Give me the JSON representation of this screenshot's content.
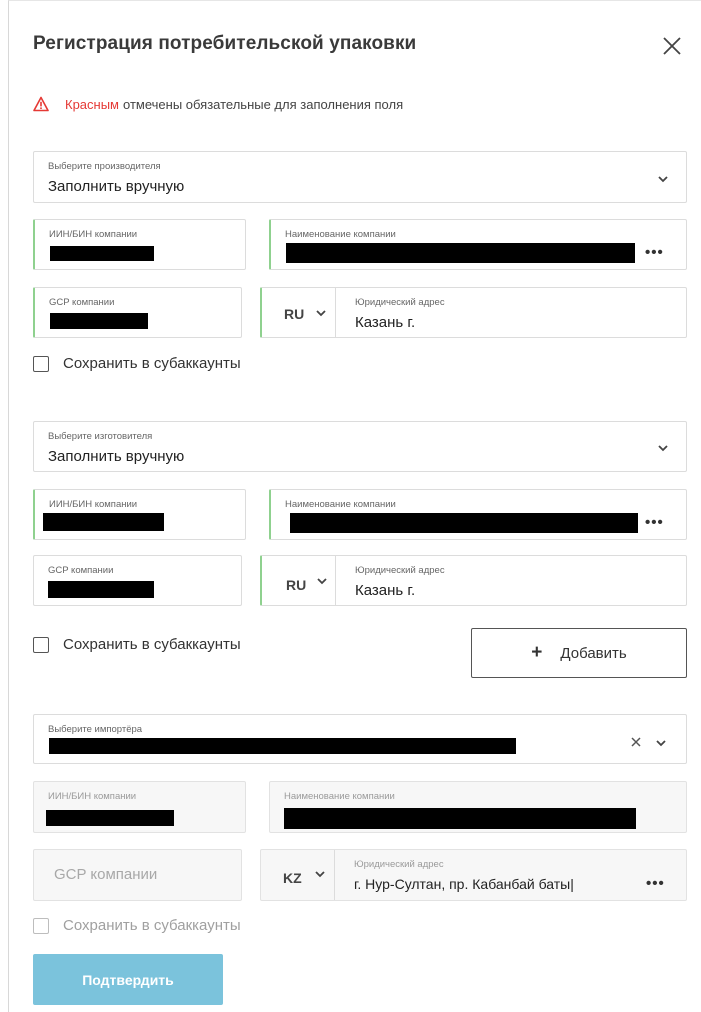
{
  "dialog": {
    "title": "Регистрация потребительской упаковки",
    "notice_red": "Красным",
    "notice_rest": "отмечены обязательные для заполнения поля",
    "colors": {
      "required": "#8fd18f",
      "confirm": "#7bc3dc",
      "warn": "#e53935"
    }
  },
  "producer": {
    "select_label": "Выберите производителя",
    "select_value": "Заполнить вручную",
    "inn_label": "ИИН/БИН компании",
    "name_label": "Наименование компании",
    "gcp_label": "GCP компании",
    "country": "RU",
    "address_label": "Юридический адрес",
    "address_value": "Казань г.",
    "save_label": "Сохранить в субаккаунты"
  },
  "manufacturer": {
    "select_label": "Выберите изготовителя",
    "select_value": "Заполнить вручную",
    "inn_label": "ИИН/БИН компании",
    "name_label": "Наименование компании",
    "gcp_label": "GCP компании",
    "country": "RU",
    "address_label": "Юридический адрес",
    "address_value": "Казань г.",
    "save_label": "Сохранить в субаккаунты",
    "add_label": "Добавить"
  },
  "importer": {
    "select_label": "Выберите импортёра",
    "inn_label": "ИИН/БИН компании",
    "name_label": "Наименование компании",
    "gcp_placeholder": "GCP компании",
    "country": "KZ",
    "address_label": "Юридический адрес",
    "address_value": "г. Нур-Султан, пр. Кабанбай баты|",
    "save_label": "Сохранить в субаккаунты"
  },
  "confirm_label": "Подтвердить"
}
